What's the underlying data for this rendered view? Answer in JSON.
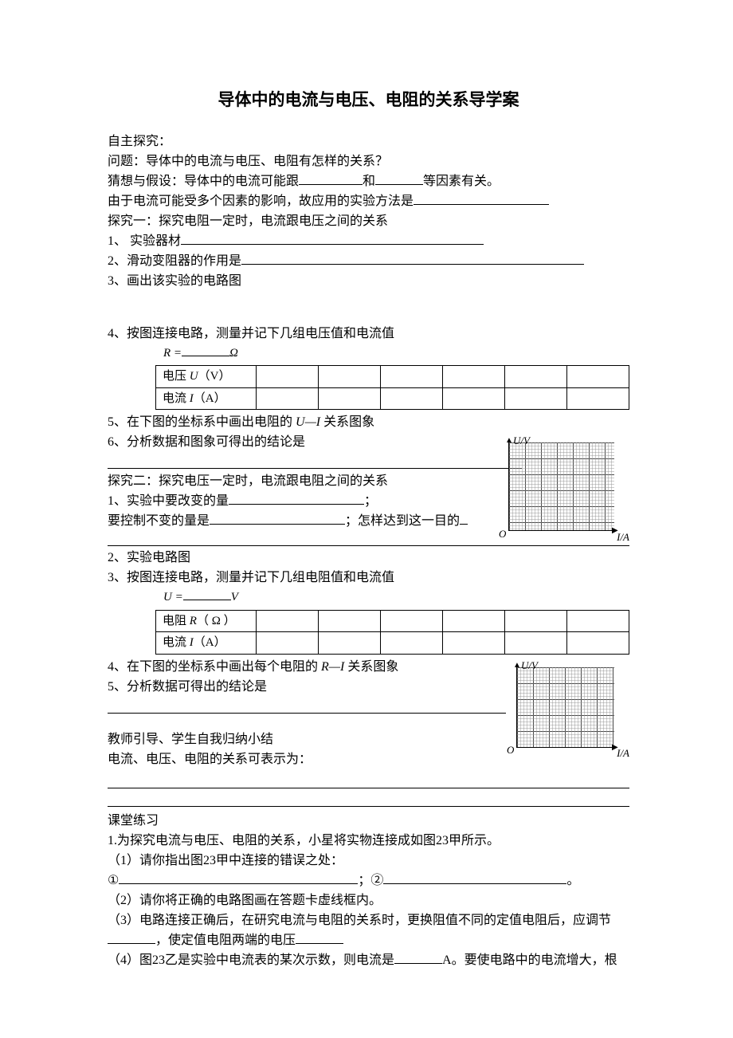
{
  "title": "导体中的电流与电压、电阻的关系导学案",
  "intro": {
    "h1": "自主探究：",
    "q": "问题：导体中的电流与电压、电阻有怎样的关系？",
    "hyp_a": "猜想与假设：导体中的电流可能跟",
    "hyp_and": "和",
    "hyp_b": "等因素有关。",
    "reason": "由于电流可能受多个因素的影响，故应用的实验方法是"
  },
  "exp1": {
    "title": "探究一：探究电阻一定时，电流跟电压之间的关系",
    "i1": "1、 实验器材",
    "i2": "2、滑动变阻器的作用是",
    "i3": "3、画出该实验的电路图",
    "i4": "4、按图连接电路，测量并记下几组电压值和电流值",
    "cap_pre": "R",
    "cap_eq": " =",
    "cap_unit": "Ω",
    "row1_a": "电压 ",
    "row1_b": "U",
    "row1_c": "（V）",
    "row2_a": "电流 ",
    "row2_b": "I",
    "row2_c": "（A）",
    "i5a": "5、在下图的坐标系中画出电阻的 ",
    "i5b": "U—I",
    "i5c": " 关系图象",
    "i6": "6、分析数据和图象可得出的结论是"
  },
  "exp2": {
    "title": "探究二：探究电压一定时，电流跟电阻之间的关系",
    "i1": "1、实验中要改变的量",
    "i1b": "；",
    "i1c": "  要控制不变的量是",
    "i1d": "；怎样达到这一目的",
    "i2": "2、实验电路图",
    "i3": "3、按图连接电路，测量并记下几组电阻值和电流值",
    "cap_pre": "U",
    "cap_eq": " =",
    "cap_unit": "V",
    "row1_a": "电阻 ",
    "row1_b": "R",
    "row1_c": "（ Ω ）",
    "row2_a": "电流 ",
    "row2_b": "I",
    "row2_c": "（A）",
    "i4a": "4、在下图的坐标系中画出每个电阻的 ",
    "i4b": "R—I",
    "i4c": " 关系图象",
    "i5": "5、分析数据可得出的结论是"
  },
  "summary": {
    "l1": "教师引导、学生自我归纳小结",
    "l2": "电流、电压、电阻的关系可表示为："
  },
  "practice": {
    "h": "课堂练习",
    "p1": "1.为探究电流与电压、电阻的关系，小星将实物连接成如图23甲所示。",
    "p1_1": "（1）请你指出图23甲中连接的错误之处：",
    "p1_1a": "①",
    "p1_1b": "；②",
    "p1_1c": "。",
    "p1_2": "（2）请你将正确的电路图画在答题卡虚线框内。",
    "p1_3a": "（3）电路连接正确后，在研究电流与电阻的关系时，更换阻值不同的定值电阻后，应调节",
    "p1_3b": "，使定值电阻两端的电压",
    "p1_4a": "（4）图23乙是实验中电流表的某次示数，则电流是",
    "p1_4b": "A。要使电路中的电流增大，根"
  },
  "chart": {
    "y": "U/V",
    "x": "I/A",
    "o": "O"
  }
}
